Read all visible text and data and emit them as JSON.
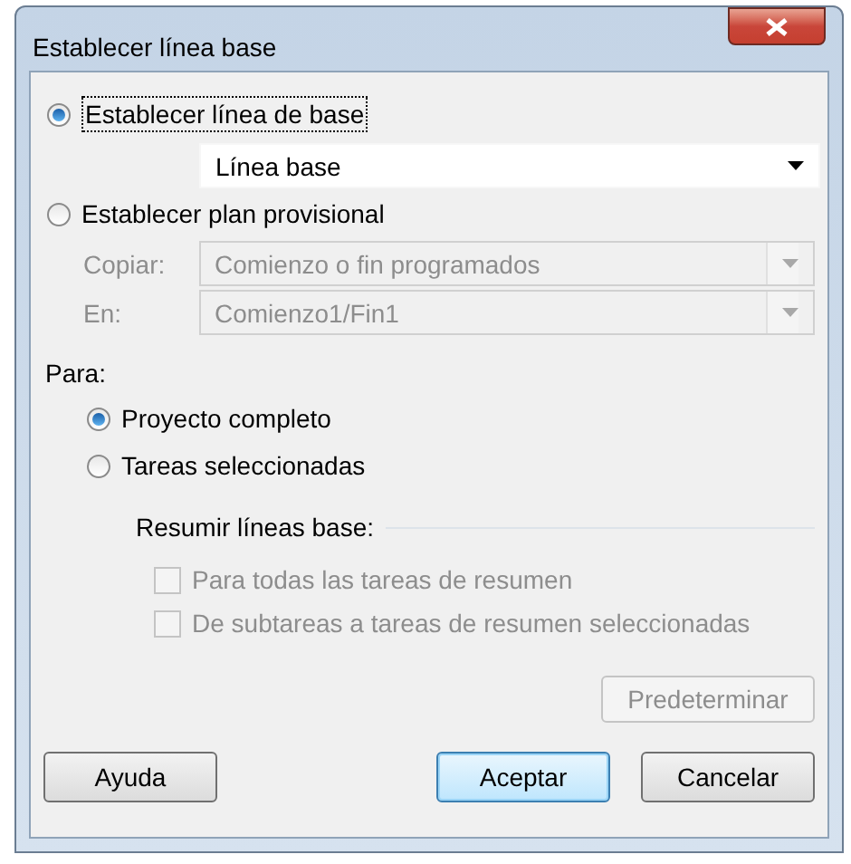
{
  "window": {
    "title": "Establecer línea base"
  },
  "mode_options": [
    {
      "label": "Establecer línea de base",
      "selected": true
    },
    {
      "label": "Establecer plan provisional",
      "selected": false
    }
  ],
  "baseline_select": {
    "value": "Línea base",
    "disabled": false
  },
  "interim_fields": [
    {
      "label": "Copiar:",
      "value": "Comienzo o fin programados",
      "disabled": true
    },
    {
      "label": "En:",
      "value": "Comienzo1/Fin1",
      "disabled": true
    }
  ],
  "scope": {
    "label": "Para:",
    "options": [
      {
        "label": "Proyecto completo",
        "selected": true
      },
      {
        "label": "Tareas seleccionadas",
        "selected": false
      }
    ]
  },
  "rollup": {
    "label": "Resumir líneas base:",
    "options": [
      {
        "label": "Para todas las tareas de resumen",
        "checked": false,
        "disabled": true
      },
      {
        "label": "De subtareas a tareas de resumen seleccionadas",
        "checked": false,
        "disabled": true
      }
    ]
  },
  "set_default_button": {
    "label": "Predeterminar",
    "disabled": true
  },
  "buttons": [
    {
      "label": "Ayuda",
      "default": false
    },
    {
      "label": "Aceptar",
      "default": true
    },
    {
      "label": "Cancelar",
      "default": false
    }
  ]
}
